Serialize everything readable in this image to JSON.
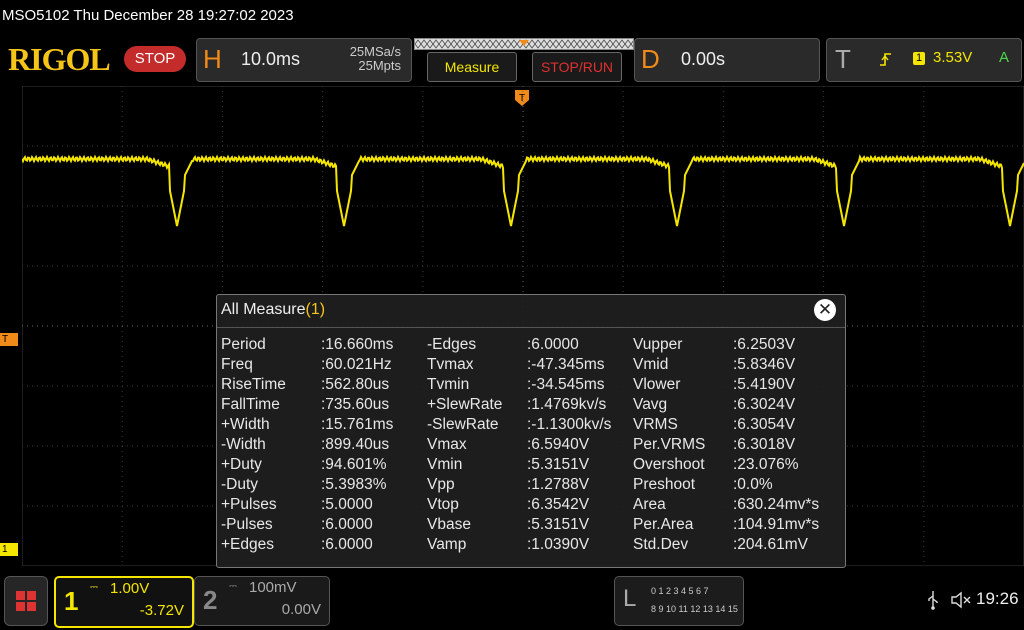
{
  "title_bar": {
    "text": "MSO5102  Thu December 28 19:27:02 2023"
  },
  "header": {
    "logo": "RIGOL",
    "run_state": "STOP",
    "horizontal": {
      "letter": "H",
      "timebase": "10.0ms",
      "sample_rate": "25MSa/s",
      "memory_depth": "25Mpts"
    },
    "measure_button": "Measure",
    "stop_run_button": "STOP/RUN",
    "delay": {
      "letter": "D",
      "value": "0.00s"
    },
    "trigger": {
      "letter": "T",
      "source": "1",
      "level": "3.53V",
      "mode": "A"
    }
  },
  "markers": {
    "trigger_position": "T",
    "trigger_level": "T",
    "channel1": "1"
  },
  "waveform": {
    "color": "#f5e600",
    "period_ms": 16.66,
    "min_v": 5.3151,
    "max_v": 6.594
  },
  "dialog": {
    "title": "All Measure",
    "count": "(1)",
    "close": "✕",
    "columns": [
      [
        [
          "Period",
          ":16.660ms"
        ],
        [
          "Freq",
          ":60.021Hz"
        ],
        [
          "RiseTime",
          ":562.80us"
        ],
        [
          "FallTime",
          ":735.60us"
        ],
        [
          "+Width",
          ":15.761ms"
        ],
        [
          "-Width",
          ":899.40us"
        ],
        [
          "+Duty",
          ":94.601%"
        ],
        [
          "-Duty",
          ":5.3983%"
        ],
        [
          "+Pulses",
          ":5.0000"
        ],
        [
          "-Pulses",
          ":6.0000"
        ],
        [
          "+Edges",
          ":6.0000"
        ]
      ],
      [
        [
          "-Edges",
          ":6.0000"
        ],
        [
          "Tvmax",
          ":-47.345ms"
        ],
        [
          "Tvmin",
          ":-34.545ms"
        ],
        [
          "+SlewRate",
          ":1.4769kv/s"
        ],
        [
          "-SlewRate",
          ":-1.1300kv/s"
        ],
        [
          "Vmax",
          ":6.5940V"
        ],
        [
          "Vmin",
          ":5.3151V"
        ],
        [
          "Vpp",
          ":1.2788V"
        ],
        [
          "Vtop",
          ":6.3542V"
        ],
        [
          "Vbase",
          ":5.3151V"
        ],
        [
          "Vamp",
          ":1.0390V"
        ]
      ],
      [
        [
          "Vupper",
          ":6.2503V"
        ],
        [
          "Vmid",
          ":5.8346V"
        ],
        [
          "Vlower",
          ":5.4190V"
        ],
        [
          "Vavg",
          ":6.3024V"
        ],
        [
          "VRMS",
          ":6.3054V"
        ],
        [
          "Per.VRMS",
          ":6.3018V"
        ],
        [
          "Overshoot",
          ":23.076%"
        ],
        [
          "Preshoot",
          ":0.0%"
        ],
        [
          "Area",
          ":630.24mv*s"
        ],
        [
          "Per.Area",
          ":104.91mv*s"
        ],
        [
          "Std.Dev",
          ":204.61mV"
        ]
      ]
    ]
  },
  "footer": {
    "ch1": {
      "number": "1",
      "scale": "1.00V",
      "offset": "-3.72V"
    },
    "ch2": {
      "number": "2",
      "scale": "100mV",
      "offset": "0.00V"
    },
    "logic": {
      "letter": "L",
      "row1": "0 1 2 3  4 5 6 7",
      "row2": "8 9 10 11 12 13 14 15"
    },
    "usb_icon": "usb-icon",
    "sound_icon": "speaker-muted-icon",
    "time": "19:26"
  }
}
